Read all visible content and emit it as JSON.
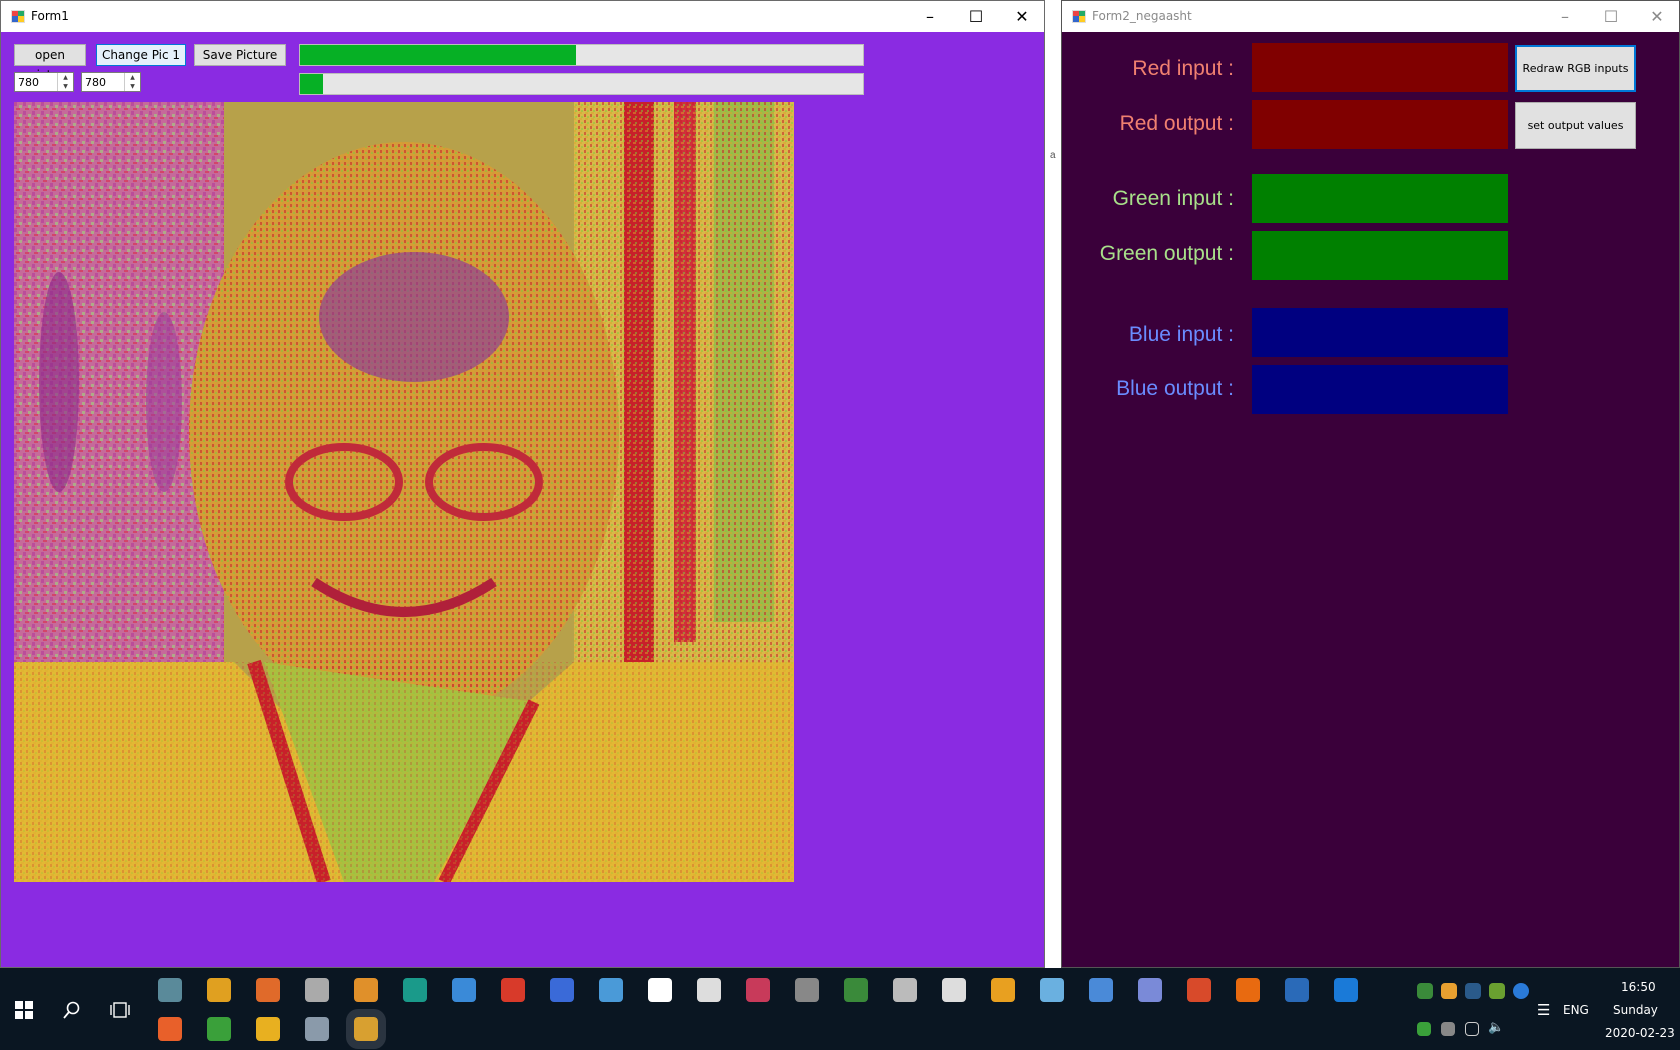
{
  "form1": {
    "title": "Form1",
    "buttons": {
      "open": "open picture",
      "change": "Change Pic 1",
      "save": "Save Picture"
    },
    "width_value": "780",
    "height_value": "780",
    "progress1": 0.49,
    "progress2": 0.04
  },
  "form2": {
    "title": "Form2_negaasht",
    "labels": {
      "red_input": "Red input :",
      "red_output": "Red output :",
      "green_input": "Green input :",
      "green_output": "Green output :",
      "blue_input": "Blue input :",
      "blue_output": "Blue output :"
    },
    "buttons": {
      "redraw": "Redraw RGB inputs",
      "set_output": "set output values"
    },
    "colors": {
      "background": "#3a003a",
      "red_label": "#f08070",
      "green_label": "#a8e08a",
      "blue_label": "#6a8cff",
      "red_swatch": "#800000",
      "green_swatch": "#008000",
      "blue_swatch": "#000080"
    }
  },
  "gap_strip_text": "a",
  "taskbar": {
    "language": "ENG",
    "time": "16:50",
    "day": "Sunday",
    "date": "2020-02-23",
    "pinned_icons": [
      "windows-start-icon",
      "search-icon",
      "task-view-icon",
      "app-icon-1",
      "app-icon-2",
      "app-icon-3",
      "app-icon-4",
      "media-player-icon",
      "edge-legacy-icon",
      "app-icon-5",
      "office-icon",
      "app-icon-6",
      "app-icon-7",
      "document-icon",
      "calculator-icon",
      "app-icon-8",
      "app-icon-9",
      "app-icon-10",
      "app-icon-11",
      "piano-icon",
      "app-icon-12",
      "app-icon-13",
      "app-icon-14",
      "app-icon-15",
      "matlab-icon",
      "vlc-icon",
      "app-icon-16",
      "edge-icon",
      "firefox-icon",
      "csharp-icon",
      "file-explorer-icon",
      "app-icon-17",
      "form-app-icon"
    ]
  }
}
